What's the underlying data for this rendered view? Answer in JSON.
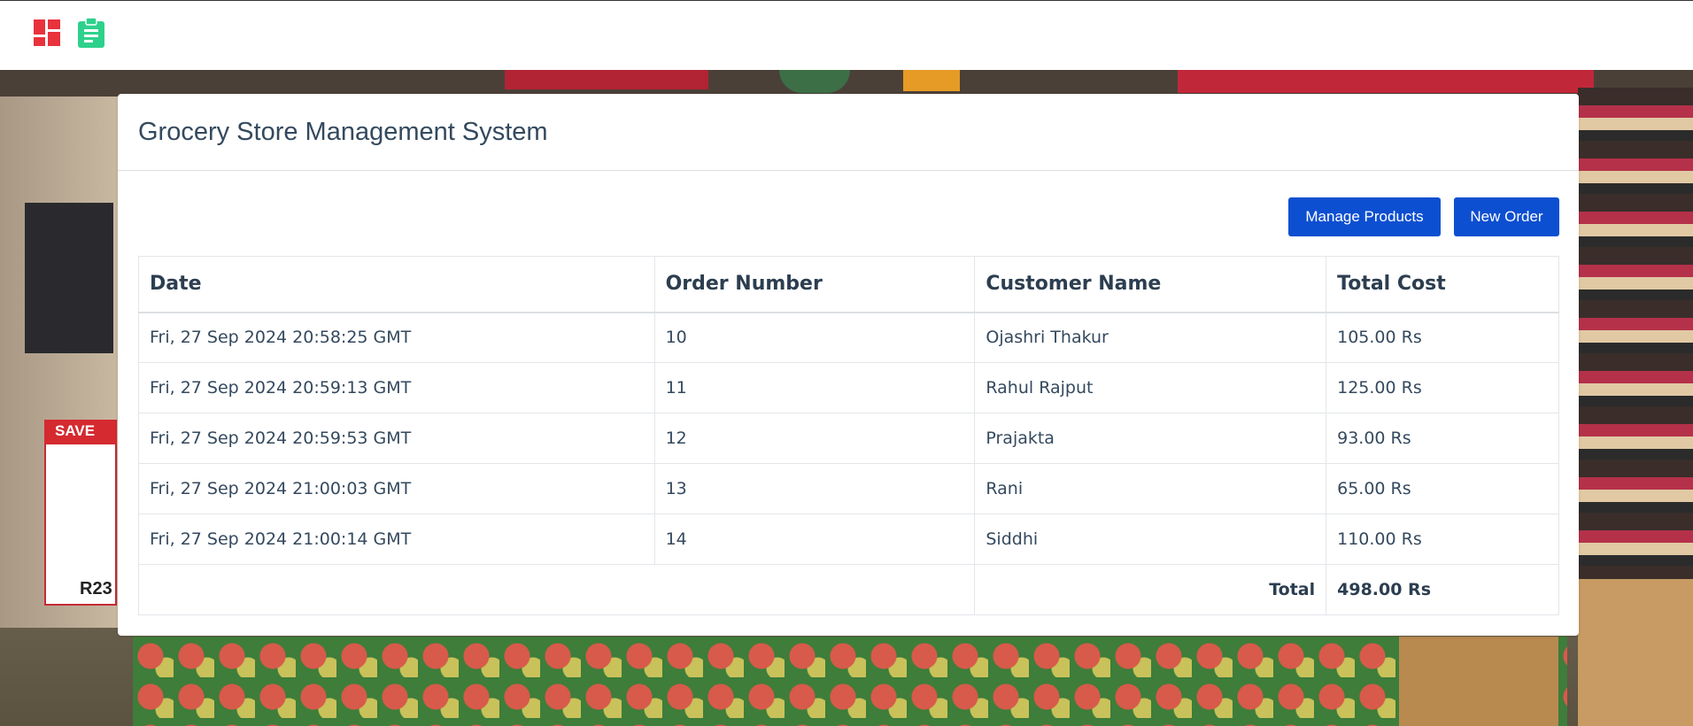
{
  "header": {
    "icons": [
      "dashboard-icon",
      "clipboard-icon"
    ],
    "colors": {
      "dashboard": "#e8323c",
      "clipboard": "#2ed18c"
    }
  },
  "card": {
    "title": "Grocery Store Management System",
    "buttons": {
      "manage_products": "Manage Products",
      "new_order": "New Order"
    },
    "accent": "#0d4fd1"
  },
  "table": {
    "columns": [
      "Date",
      "Order Number",
      "Customer Name",
      "Total Cost"
    ],
    "rows": [
      {
        "date": "Fri, 27 Sep 2024 20:58:25 GMT",
        "order_number": "10",
        "customer": "Ojashri Thakur",
        "total": "105.00 Rs"
      },
      {
        "date": "Fri, 27 Sep 2024 20:59:13 GMT",
        "order_number": "11",
        "customer": "Rahul Rajput",
        "total": "125.00 Rs"
      },
      {
        "date": "Fri, 27 Sep 2024 20:59:53 GMT",
        "order_number": "12",
        "customer": "Prajakta",
        "total": "93.00 Rs"
      },
      {
        "date": "Fri, 27 Sep 2024 21:00:03 GMT",
        "order_number": "13",
        "customer": "Rani",
        "total": "65.00 Rs"
      },
      {
        "date": "Fri, 27 Sep 2024 21:00:14 GMT",
        "order_number": "14",
        "customer": "Siddhi",
        "total": "110.00 Rs"
      }
    ],
    "footer": {
      "label": "Total",
      "value": "498.00 Rs"
    }
  },
  "background": {
    "sign_label": "SAVE",
    "sign_price": "R23"
  }
}
